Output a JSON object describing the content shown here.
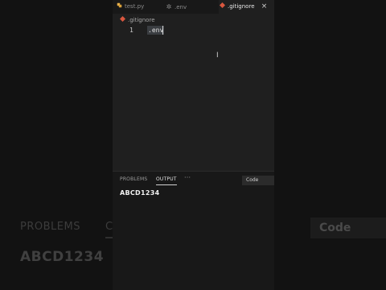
{
  "tabs": [
    {
      "label": "test.py",
      "icon": "python-icon"
    },
    {
      "label": ".env",
      "icon": "gear-icon"
    },
    {
      "label": ".gitignore",
      "icon": "git-icon",
      "close_symbol": "×"
    }
  ],
  "breadcrumb": ".gitignore",
  "editor": {
    "line_number": "1",
    "line_text": ".env"
  },
  "panel": {
    "problems_label": "PROBLEMS",
    "output_label": "OUTPUT",
    "more_label": "···",
    "channel_label": "Code",
    "output_text": "ABCD1234"
  },
  "colors": {
    "python": "#e8b04a",
    "git": "#d9573f",
    "gear": "#8a8a8a"
  }
}
